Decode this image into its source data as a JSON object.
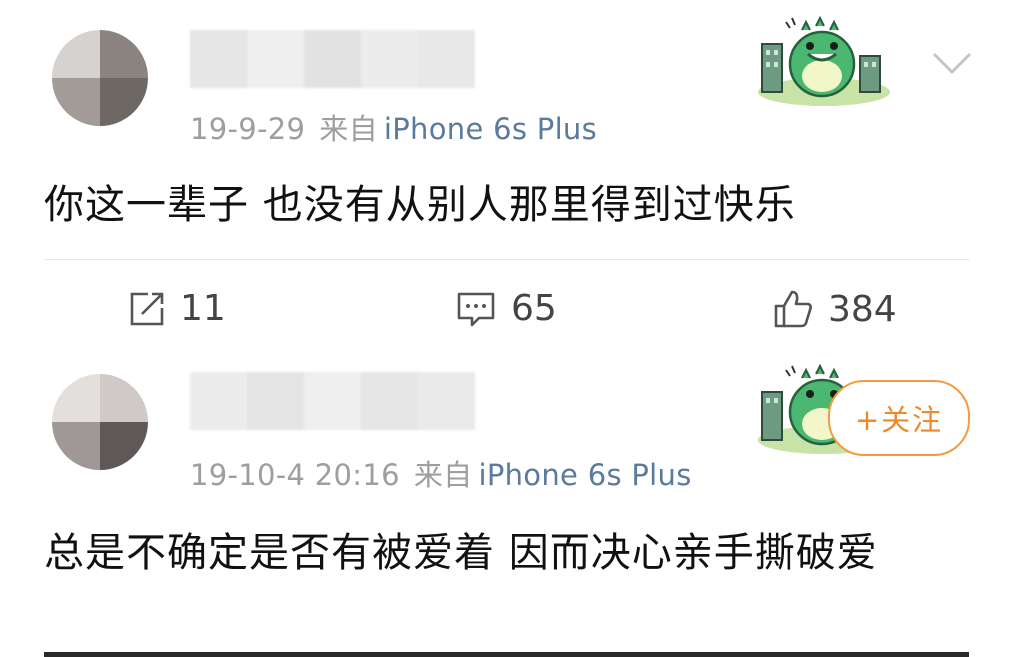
{
  "colors": {
    "meta_gray": "#9e9e9e",
    "device_blue": "#5b7a9e",
    "follow_orange": "#ee8a2a",
    "text": "#111111"
  },
  "post1": {
    "date": "19-9-29",
    "source_prefix": "来自",
    "device": "iPhone 6s Plus",
    "content": "你这一辈子 也没有从别人那里得到过快乐",
    "badge_icon": "dinosaur-badge-icon",
    "menu_icon": "chevron-down-icon"
  },
  "actions": {
    "repost": {
      "icon": "share-icon",
      "count": "11"
    },
    "comment": {
      "icon": "comment-icon",
      "count": "65"
    },
    "like": {
      "icon": "thumbs-up-icon",
      "count": "384"
    }
  },
  "post2": {
    "date": "19-10-4 20:16",
    "source_prefix": "来自",
    "device": "iPhone 6s Plus",
    "content": "总是不确定是否有被爱着 因而决心亲手撕破爱",
    "follow_label": "+关注",
    "badge_icon": "dinosaur-badge-icon"
  }
}
